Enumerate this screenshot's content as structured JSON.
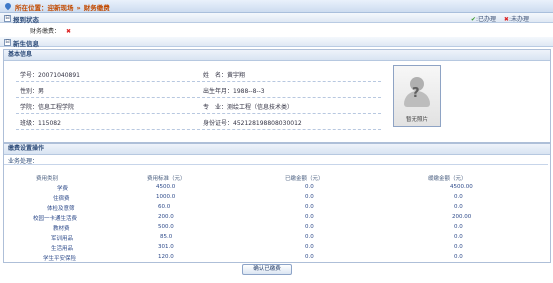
{
  "location": {
    "prefix": "所在位置：",
    "path": [
      "迎新现场",
      "财务缴费"
    ]
  },
  "status_section": {
    "title": "报到状态",
    "legend_done": "已办理",
    "legend_undone": "未办理"
  },
  "finance_status": {
    "label": "财务缴费："
  },
  "newcomer_section": {
    "title": "新生信息"
  },
  "basic_info": {
    "title": "基本信息",
    "student_id": "学号：20071040891",
    "name": "姓　名：黄宇翔",
    "gender": "性别：男",
    "birth": "出生年月：1988--8--3",
    "college": "学院：信息工程学院",
    "major": "专　业：测绘工程（信息技术类）",
    "class": "班级：115082",
    "id_card": "身份证号：452128198808030012",
    "photo_caption": "暂无照片"
  },
  "payment_section": {
    "title": "缴费设置操作",
    "business_label": "业务处理：",
    "columns": [
      "费用类别",
      "费用标准（元）",
      "已缴金额（元）",
      "缓缴金额（元）"
    ],
    "rows": [
      [
        "学费",
        "4500.0",
        "0.0",
        "4500.00"
      ],
      [
        "住宿费",
        "1000.0",
        "0.0",
        "0.0"
      ],
      [
        "体检及意筛",
        "60.0",
        "0.0",
        "0.0"
      ],
      [
        "校园一卡通生活费",
        "200.0",
        "0.0",
        "200.00"
      ],
      [
        "教材费",
        "500.0",
        "0.0",
        "0.0"
      ],
      [
        "军训用品",
        "85.0",
        "0.0",
        "0.0"
      ],
      [
        "生活用品",
        "301.0",
        "0.0",
        "0.0"
      ],
      [
        "学生平安保险",
        "120.0",
        "0.0",
        "0.0"
      ]
    ],
    "confirm_button": "确认已缴费"
  }
}
